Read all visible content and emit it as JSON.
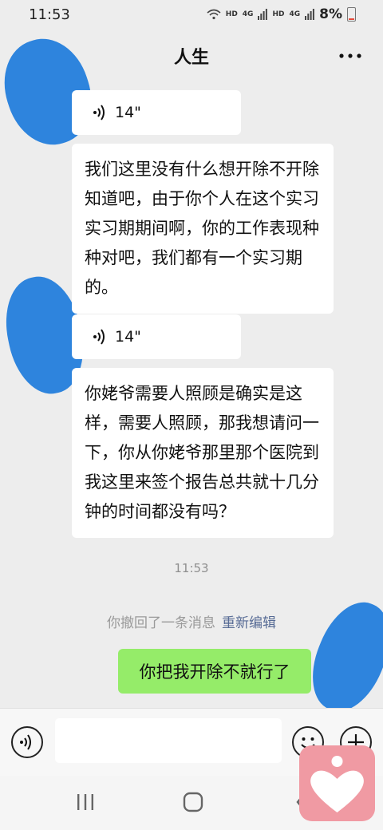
{
  "status_bar": {
    "time": "11:53",
    "net1": "HD",
    "net1_gen": "4G",
    "net2": "HD",
    "net2_gen": "4G",
    "battery": "8%"
  },
  "nav": {
    "title": "人生"
  },
  "messages": [
    {
      "type": "voice",
      "duration": "14\""
    },
    {
      "type": "text",
      "text": "我们这里没有什么想开除不开除知道吧，由于你个人在这个实习实习期期间啊，你的工作表现种种对吧，我们都有一个实习期的。"
    },
    {
      "type": "voice",
      "duration": "14\""
    },
    {
      "type": "text",
      "text": "你姥爷需要人照顾是确实是这样，需要人照顾，那我想请问一下，你从你姥爷那里那个医院到我这里来签个报告总共就十几分钟的时间都没有吗？"
    }
  ],
  "timestamp": "11:53",
  "recall": {
    "notice": "你撤回了一条消息",
    "reedit": "重新编辑"
  },
  "my_message": "你把我开除不就行了",
  "input": {
    "value": "",
    "placeholder": ""
  },
  "icons": {
    "back": "chevron-left-icon",
    "more": "more-dots-icon",
    "voice": "voice-wave-icon",
    "emoji": "smiley-icon",
    "plus": "plus-circle-icon",
    "recents": "recents-icon",
    "home": "home-icon",
    "sys_back": "system-back-icon"
  },
  "colors": {
    "background": "#ededed",
    "bubble_in": "#ffffff",
    "bubble_out": "#95ec69",
    "link": "#576b95",
    "scribble": "#2e84dd",
    "watermark": "#f09aa3"
  }
}
